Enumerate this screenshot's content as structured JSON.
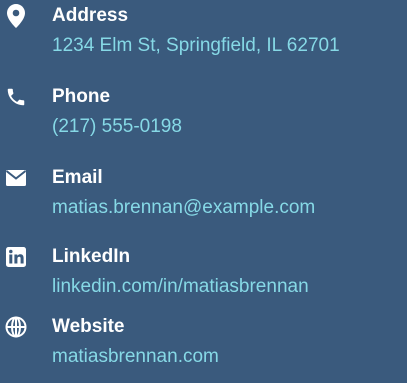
{
  "colors": {
    "background": "#3a5a7d",
    "label": "#ffffff",
    "value": "#86d9e6"
  },
  "contacts": [
    {
      "icon": "map-marker-icon",
      "label": "Address",
      "value": "1234 Elm St, Springfield, IL 62701"
    },
    {
      "icon": "phone-icon",
      "label": "Phone",
      "value": "(217) 555-0198"
    },
    {
      "icon": "envelope-icon",
      "label": "Email",
      "value": "matias.brennan@example.com"
    },
    {
      "icon": "linkedin-icon",
      "label": "LinkedIn",
      "value": "linkedin.com/in/matiasbrennan"
    },
    {
      "icon": "globe-icon",
      "label": "Website",
      "value": "matiasbrennan.com"
    }
  ]
}
